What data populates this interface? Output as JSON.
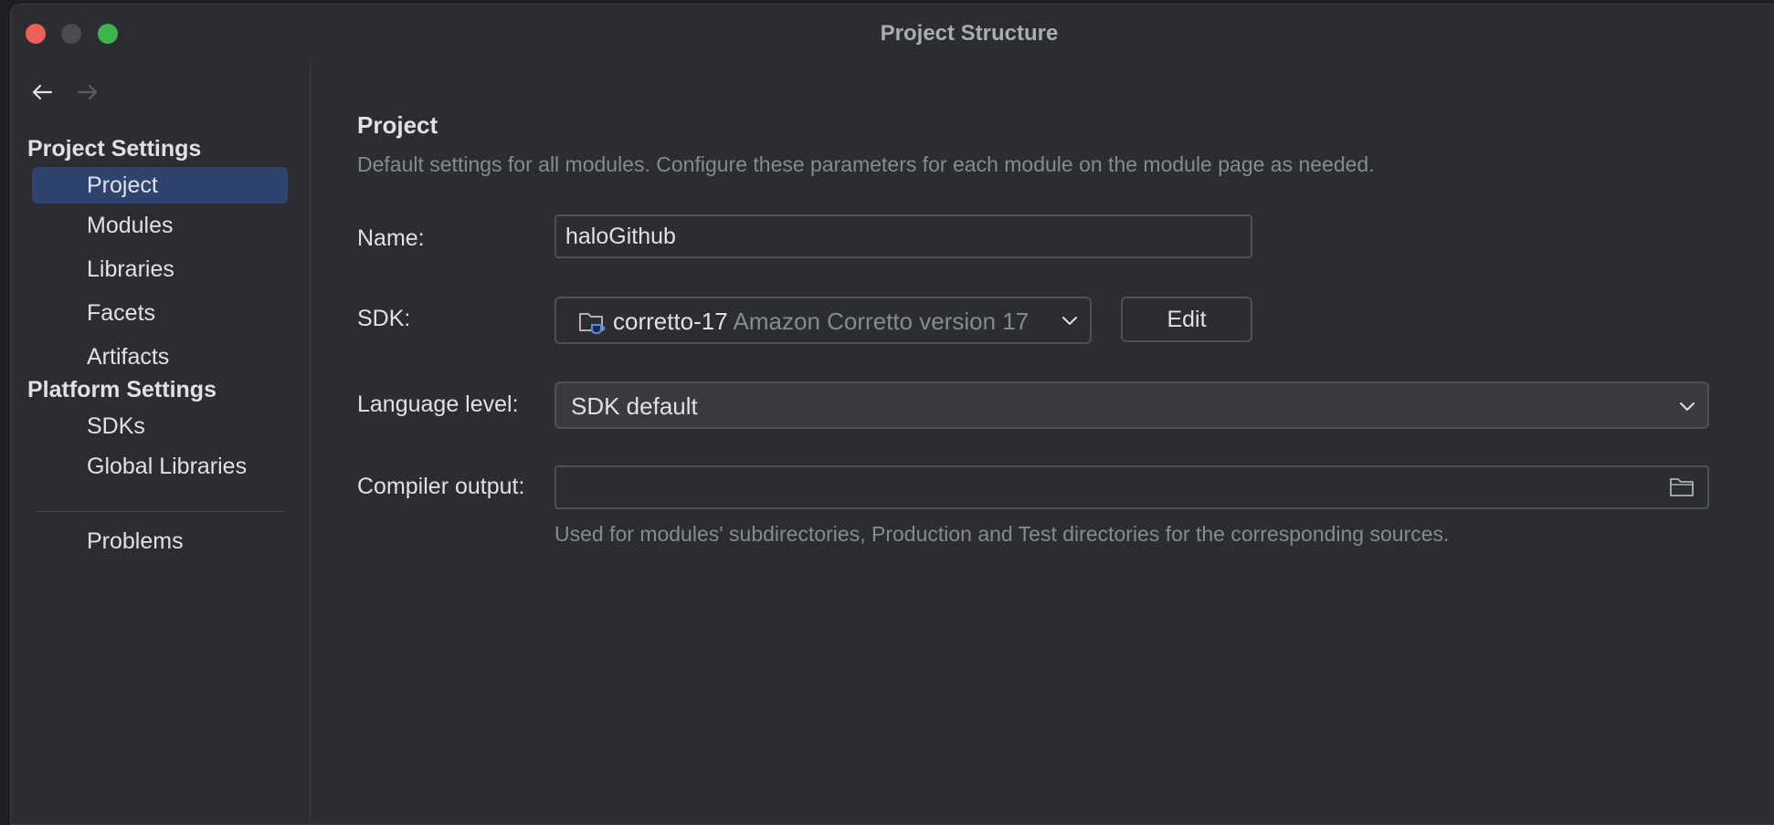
{
  "window": {
    "title": "Project Structure"
  },
  "sidebar": {
    "project_settings_title": "Project Settings",
    "project_items": [
      {
        "label": "Project",
        "selected": true
      },
      {
        "label": "Modules"
      },
      {
        "label": "Libraries"
      },
      {
        "label": "Facets"
      },
      {
        "label": "Artifacts"
      }
    ],
    "platform_settings_title": "Platform Settings",
    "platform_items": [
      {
        "label": "SDKs"
      },
      {
        "label": "Global Libraries"
      }
    ],
    "problems_label": "Problems"
  },
  "main": {
    "title": "Project",
    "description": "Default settings for all modules. Configure these parameters for each module on the module page as needed.",
    "name_label": "Name:",
    "name_value": "haloGithub",
    "sdk_label": "SDK:",
    "sdk_name": "corretto-17",
    "sdk_description": "Amazon Corretto version 17",
    "edit_label": "Edit",
    "language_level_label": "Language level:",
    "language_level_value": "SDK default",
    "compiler_output_label": "Compiler output:",
    "compiler_output_value": "",
    "compiler_output_hint": "Used for modules' subdirectories, Production and Test directories for the corresponding sources."
  },
  "colors": {
    "window_bg": "#2b2d30",
    "selection": "#2e436e",
    "text": "#dfe1e5",
    "muted_text": "#868a91",
    "close": "#ee5f57",
    "zoom": "#3fb34f"
  }
}
